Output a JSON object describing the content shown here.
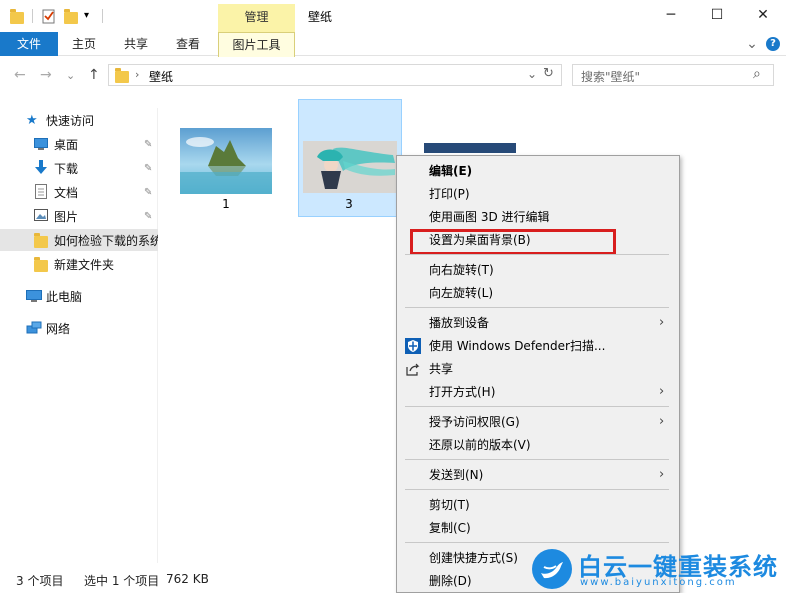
{
  "window": {
    "title": "壁纸",
    "manage_tab": "管理",
    "minimize": "─",
    "maximize": "☐",
    "close": "✕"
  },
  "ribbon": {
    "tabs": [
      "文件",
      "主页",
      "共享",
      "查看",
      "图片工具"
    ],
    "collapse_glyph": "⌄",
    "help_glyph": "?"
  },
  "address": {
    "path": "壁纸",
    "back": "←",
    "forward": "→",
    "recent": "⌄",
    "up": "↑",
    "dropdown": "⌄",
    "refresh": "↻",
    "search_placeholder": "搜索\"壁纸\"",
    "search_glyph": "⌕"
  },
  "sidebar": {
    "quick_access": "快速访问",
    "items": [
      {
        "label": "桌面",
        "icon": "desktop-icon",
        "pinned": true
      },
      {
        "label": "下载",
        "icon": "download-icon",
        "pinned": true
      },
      {
        "label": "文档",
        "icon": "document-icon",
        "pinned": true
      },
      {
        "label": "图片",
        "icon": "picture-icon",
        "pinned": true
      },
      {
        "label": "如何检验下载的系统",
        "icon": "folder-icon",
        "pinned": false
      },
      {
        "label": "新建文件夹",
        "icon": "folder-icon",
        "pinned": false
      }
    ],
    "this_pc": "此电脑",
    "network": "网络",
    "pin_glyph": "📌"
  },
  "files": [
    {
      "name": "1"
    },
    {
      "name": "3"
    }
  ],
  "context_menu": {
    "items": [
      {
        "label": "编辑(E)",
        "bold": true
      },
      {
        "label": "打印(P)"
      },
      {
        "label": "使用画图 3D 进行编辑"
      },
      {
        "label": "设置为桌面背景(B)",
        "highlighted": true
      },
      {
        "label": "向右旋转(T)"
      },
      {
        "label": "向左旋转(L)"
      },
      {
        "label": "播放到设备",
        "submenu": true
      },
      {
        "label": "使用 Windows Defender扫描...",
        "icon": "defender-shield-icon"
      },
      {
        "label": "共享",
        "icon": "share-icon"
      },
      {
        "label": "打开方式(H)",
        "submenu": true
      },
      {
        "label": "授予访问权限(G)",
        "submenu": true
      },
      {
        "label": "还原以前的版本(V)"
      },
      {
        "label": "发送到(N)",
        "submenu": true
      },
      {
        "label": "剪切(T)"
      },
      {
        "label": "复制(C)"
      },
      {
        "label": "创建快捷方式(S)"
      },
      {
        "label": "删除(D)"
      }
    ],
    "chevron": "›"
  },
  "status": {
    "count": "3 个项目",
    "selected": "选中 1 个项目",
    "size": "762 KB"
  },
  "watermark": {
    "main": "白云一键重装系统",
    "sub": "www.baiyunxitong.com"
  },
  "colors": {
    "accent": "#1979ca",
    "selection": "#cce8ff",
    "highlight_box": "#d81e1e",
    "manage_tab": "#fbf3a8"
  }
}
